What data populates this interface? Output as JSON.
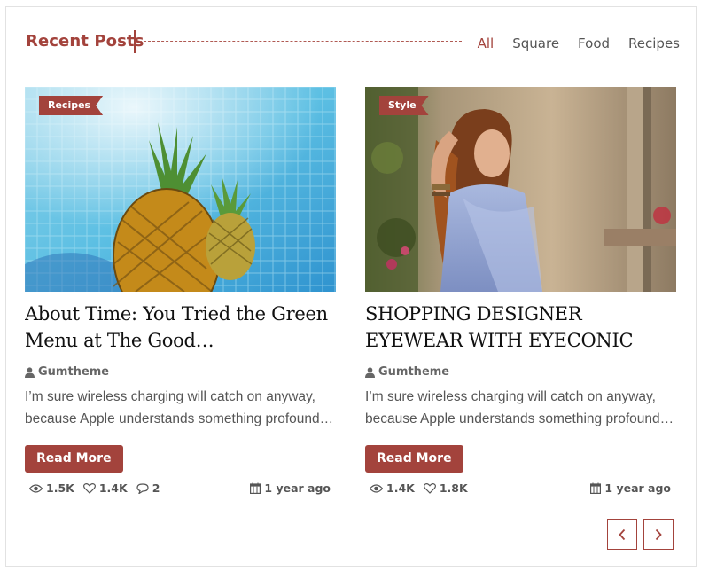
{
  "header": {
    "title": "Recent Posts",
    "filters": [
      {
        "label": "All",
        "active": true
      },
      {
        "label": "Square",
        "active": false
      },
      {
        "label": "Food",
        "active": false
      },
      {
        "label": "Recipes",
        "active": false
      }
    ]
  },
  "posts": [
    {
      "category": "Recipes",
      "title": "About Time: You Tried the Green Menu at The Good…",
      "author": "Gumtheme",
      "excerpt": [
        "I’m sure wireless charging will catch on anyway,",
        "because Apple understands something profound…"
      ],
      "read_more": "Read More",
      "views": "1.5K",
      "likes": "1.4K",
      "comments": "2",
      "date": "1 year ago",
      "image": "pineapples-in-pool"
    },
    {
      "category": "Style",
      "title": "SHOPPING DESIGNER EYEWEAR WITH EYECONIC",
      "author": "Gumtheme",
      "excerpt": [
        "I’m sure wireless charging will catch on anyway,",
        "because Apple understands something profound…"
      ],
      "read_more": "Read More",
      "views": "1.4K",
      "likes": "1.8K",
      "date": "1 year ago",
      "image": "woman-in-blue-dress"
    }
  ],
  "pager": {
    "prev_icon": "chevron-left-icon",
    "next_icon": "chevron-right-icon"
  },
  "colors": {
    "accent": "#a3433c",
    "text": "#111111",
    "muted": "#555555"
  }
}
